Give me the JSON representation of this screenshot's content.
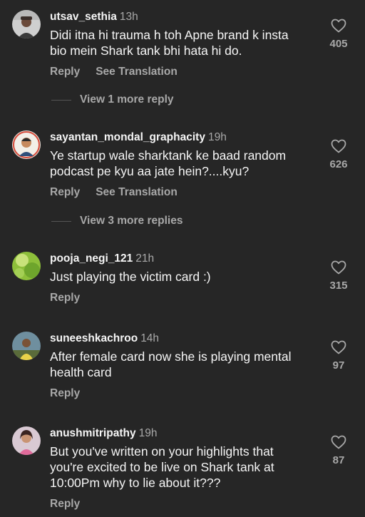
{
  "comments": [
    {
      "username": "utsav_sethia",
      "time": "13h",
      "text": "Didi itna hi trauma h toh Apne brand k insta\nbio mein Shark tank bhi hata hi do.",
      "reply_label": "Reply",
      "translate_label": "See Translation",
      "likes": "405",
      "view_replies": "View 1 more reply",
      "avatar_icon": "person-avatar-icon"
    },
    {
      "username": "sayantan_mondal_graphacity",
      "time": "19h",
      "text": "Ye startup wale sharktank ke baad random\npodcast pe kyu aa jate hein?....kyu?",
      "reply_label": "Reply",
      "translate_label": "See Translation",
      "likes": "626",
      "view_replies": "View 3 more replies",
      "avatar_icon": "illustrated-avatar-icon"
    },
    {
      "username": "pooja_negi_121",
      "time": "21h",
      "text": "Just playing the victim card :)",
      "reply_label": "Reply",
      "likes": "315",
      "avatar_icon": "green-leaf-avatar-icon"
    },
    {
      "username": "suneeshkachroo",
      "time": "14h",
      "text": "After female card now she is playing mental\nhealth card",
      "reply_label": "Reply",
      "likes": "97",
      "avatar_icon": "person-avatar-icon"
    },
    {
      "username": "anushmitripathy",
      "time": "19h",
      "text": "But you've written on your highlights that\nyou're excited to be live on Shark tank at\n10:00Pm why to lie about it???",
      "reply_label": "Reply",
      "likes": "87",
      "avatar_icon": "person-avatar-icon"
    }
  ],
  "colors": {
    "background": "#262626",
    "primary_text": "#f5f5f5",
    "secondary_text": "#a8a8a8"
  }
}
